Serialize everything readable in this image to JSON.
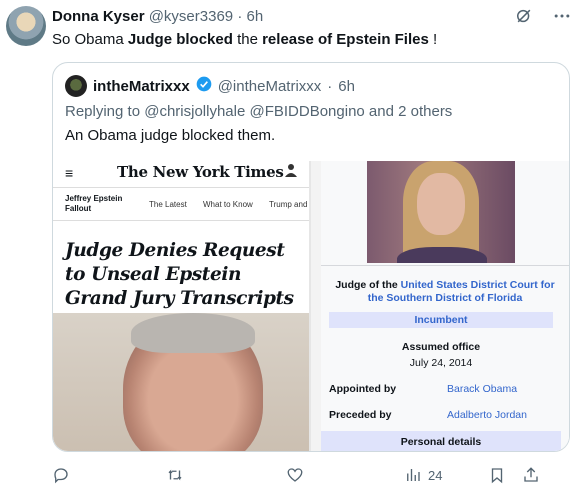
{
  "tweet": {
    "display_name": "Donna Kyser",
    "handle": "@kyser3369",
    "separator": "·",
    "time": "6h",
    "text": {
      "part1": "So Obama ",
      "part2_bold": "Judge blocked",
      "part3": " the ",
      "part4_bold": "release of Epstein Files",
      "part5": " !"
    },
    "header_icons": [
      "grok-icon",
      "more-icon"
    ]
  },
  "quote": {
    "display_name": "intheMatrixxx",
    "handle": "@intheMatrixxx",
    "separator": "·",
    "time": "6h",
    "replying_to": "Replying to @chrisjollyhale @FBIDDBongino and 2 others",
    "text": "An Obama judge blocked them.",
    "nyt": {
      "menu_icon": "≡",
      "logo": "The New York Times",
      "section": "Jeffrey Epstein Fallout",
      "links": [
        "The Latest",
        "What to Know",
        "Trump and"
      ],
      "headline": "Judge Denies Request to Unseal Epstein Grand Jury Transcripts in Florida"
    },
    "wiki": {
      "judge_prefix": "Judge of the ",
      "judge_link1": "United States District Court for",
      "judge_link2": "the Southern District of Florida",
      "incumbent": "Incumbent",
      "assumed_label": "Assumed office",
      "assumed_date": "July 24, 2014",
      "appointed_label": "Appointed by",
      "appointed_value": "Barack Obama",
      "preceded_label": "Preceded by",
      "preceded_value": "Adalberto Jordan",
      "personal": "Personal details"
    }
  },
  "actions": {
    "views_count": "24"
  },
  "colors": {
    "text": "#0f1419",
    "secondary": "#536471",
    "border": "#cfd9de",
    "verified": "#1d9bf0",
    "wiki_link": "#3366cc"
  }
}
